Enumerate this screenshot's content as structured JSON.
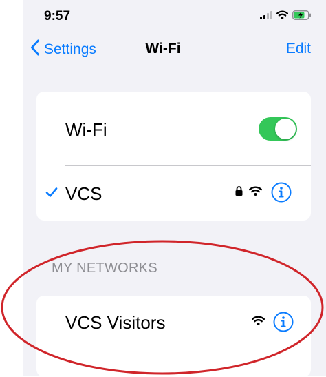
{
  "status_bar": {
    "time": "9:57"
  },
  "nav": {
    "back_label": "Settings",
    "title": "Wi-Fi",
    "edit_label": "Edit"
  },
  "wifi_toggle": {
    "label": "Wi-Fi",
    "on": true
  },
  "current_network": {
    "name": "VCS",
    "connected": true,
    "secured": true
  },
  "my_networks": {
    "header": "MY NETWORKS",
    "items": [
      {
        "name": "VCS Visitors",
        "secured": false
      }
    ]
  },
  "colors": {
    "accent": "#0a7cff",
    "toggle_on": "#34c759",
    "background": "#f2f2f7",
    "annotation": "#d0252a"
  },
  "icons": {
    "back": "chevron-left-icon",
    "check": "checkmark-icon",
    "lock": "lock-icon",
    "wifi": "wifi-icon",
    "info": "info-icon"
  }
}
